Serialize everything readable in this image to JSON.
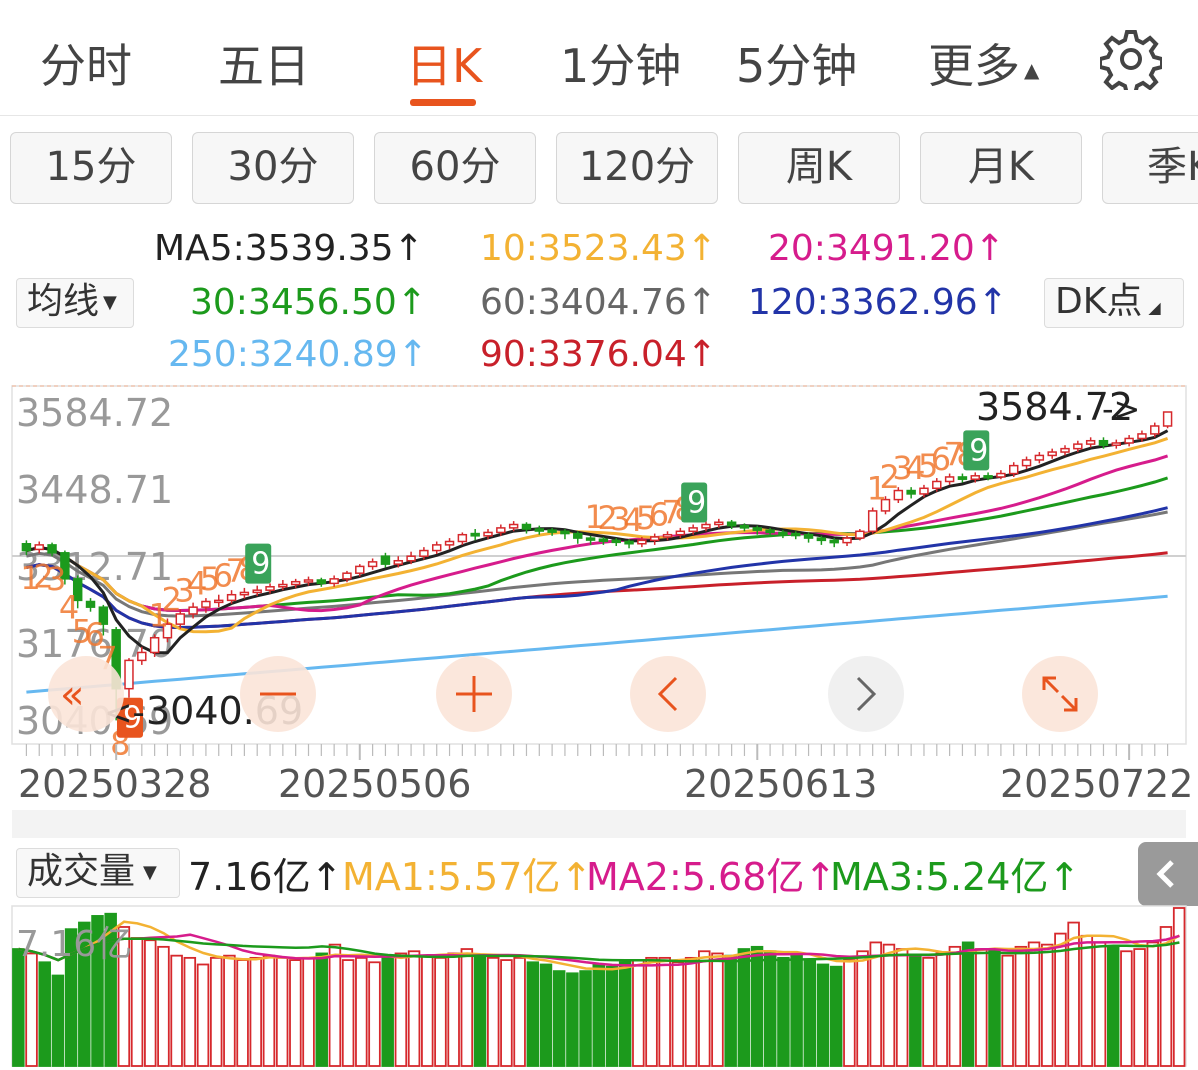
{
  "tabs": [
    {
      "label": "分时"
    },
    {
      "label": "五日"
    },
    {
      "label": "日K"
    },
    {
      "label": "1分钟"
    },
    {
      "label": "5分钟"
    },
    {
      "label": "更多"
    }
  ],
  "active_tab": "日K",
  "periods": [
    {
      "label": "15分"
    },
    {
      "label": "30分"
    },
    {
      "label": "60分"
    },
    {
      "label": "120分"
    },
    {
      "label": "周K"
    },
    {
      "label": "月K"
    },
    {
      "label": "季K"
    }
  ],
  "ma_selector": "均线",
  "dk_button": "DK点",
  "ma_legend": {
    "ma5": "MA5:3539.35↑",
    "ma10": "10:3523.43↑",
    "ma20": "20:3491.20↑",
    "ma30": "30:3456.50↑",
    "ma60": "60:3404.76↑",
    "ma120": "120:3362.96↑",
    "ma250": "250:3240.89↑",
    "ma90": "90:3376.04↑"
  },
  "colors": {
    "accent": "#e8541e",
    "up": "#d6282c",
    "down": "#1c9a1c",
    "ma5": "#222222",
    "ma10": "#f3b233",
    "ma20": "#d61c8c",
    "ma30": "#1c9a1c",
    "ma60": "#777777",
    "ma90": "#c8202a",
    "ma120": "#2234a8",
    "ma250": "#66b8f0"
  },
  "chart_data": [
    {
      "type": "candlestick",
      "y_axis_labels": [
        "3584.72",
        "3448.71",
        "3312.71",
        "3176.70",
        "3040.69"
      ],
      "ylim": [
        3040.69,
        3584.72
      ],
      "x_axis_labels": [
        "20250328",
        "20250506",
        "20250613",
        "20250722"
      ],
      "annotations": {
        "high": "3584.72",
        "low": "3040.69"
      },
      "candles": [
        {
          "o": 3352,
          "c": 3340,
          "h": 3358,
          "l": 3332
        },
        {
          "o": 3342,
          "c": 3350,
          "h": 3356,
          "l": 3335
        },
        {
          "o": 3350,
          "c": 3336,
          "h": 3354,
          "l": 3330
        },
        {
          "o": 3336,
          "c": 3290,
          "h": 3340,
          "l": 3280
        },
        {
          "o": 3290,
          "c": 3252,
          "h": 3296,
          "l": 3238
        },
        {
          "o": 3250,
          "c": 3240,
          "h": 3256,
          "l": 3232
        },
        {
          "o": 3240,
          "c": 3210,
          "h": 3244,
          "l": 3190
        },
        {
          "o": 3200,
          "c": 3096,
          "h": 3205,
          "l": 3040
        },
        {
          "o": 3096,
          "c": 3146,
          "h": 3150,
          "l": 3080
        },
        {
          "o": 3146,
          "c": 3160,
          "h": 3170,
          "l": 3138
        },
        {
          "o": 3160,
          "c": 3186,
          "h": 3192,
          "l": 3152
        },
        {
          "o": 3186,
          "c": 3210,
          "h": 3220,
          "l": 3178
        },
        {
          "o": 3210,
          "c": 3228,
          "h": 3236,
          "l": 3202
        },
        {
          "o": 3228,
          "c": 3240,
          "h": 3248,
          "l": 3220
        },
        {
          "o": 3240,
          "c": 3250,
          "h": 3256,
          "l": 3230
        },
        {
          "o": 3250,
          "c": 3252,
          "h": 3262,
          "l": 3240
        },
        {
          "o": 3252,
          "c": 3262,
          "h": 3270,
          "l": 3246
        },
        {
          "o": 3262,
          "c": 3266,
          "h": 3274,
          "l": 3255
        },
        {
          "o": 3266,
          "c": 3270,
          "h": 3278,
          "l": 3260
        },
        {
          "o": 3270,
          "c": 3276,
          "h": 3282,
          "l": 3264
        },
        {
          "o": 3276,
          "c": 3280,
          "h": 3288,
          "l": 3270
        },
        {
          "o": 3280,
          "c": 3285,
          "h": 3290,
          "l": 3274
        },
        {
          "o": 3285,
          "c": 3288,
          "h": 3294,
          "l": 3278
        },
        {
          "o": 3288,
          "c": 3282,
          "h": 3292,
          "l": 3276
        },
        {
          "o": 3282,
          "c": 3290,
          "h": 3296,
          "l": 3276
        },
        {
          "o": 3290,
          "c": 3300,
          "h": 3304,
          "l": 3284
        },
        {
          "o": 3300,
          "c": 3312,
          "h": 3316,
          "l": 3294
        },
        {
          "o": 3312,
          "c": 3320,
          "h": 3326,
          "l": 3306
        },
        {
          "o": 3330,
          "c": 3316,
          "h": 3336,
          "l": 3310
        },
        {
          "o": 3316,
          "c": 3322,
          "h": 3330,
          "l": 3310
        },
        {
          "o": 3322,
          "c": 3330,
          "h": 3338,
          "l": 3316
        },
        {
          "o": 3330,
          "c": 3340,
          "h": 3346,
          "l": 3324
        },
        {
          "o": 3340,
          "c": 3350,
          "h": 3356,
          "l": 3334
        },
        {
          "o": 3350,
          "c": 3356,
          "h": 3362,
          "l": 3342
        },
        {
          "o": 3356,
          "c": 3368,
          "h": 3372,
          "l": 3350
        },
        {
          "o": 3370,
          "c": 3366,
          "h": 3378,
          "l": 3358
        },
        {
          "o": 3366,
          "c": 3372,
          "h": 3378,
          "l": 3360
        },
        {
          "o": 3372,
          "c": 3380,
          "h": 3386,
          "l": 3366
        },
        {
          "o": 3380,
          "c": 3386,
          "h": 3392,
          "l": 3374
        },
        {
          "o": 3386,
          "c": 3378,
          "h": 3390,
          "l": 3370
        },
        {
          "o": 3378,
          "c": 3376,
          "h": 3384,
          "l": 3368
        },
        {
          "o": 3376,
          "c": 3374,
          "h": 3380,
          "l": 3366
        },
        {
          "o": 3374,
          "c": 3370,
          "h": 3378,
          "l": 3360
        },
        {
          "o": 3370,
          "c": 3362,
          "h": 3374,
          "l": 3352
        },
        {
          "o": 3362,
          "c": 3360,
          "h": 3366,
          "l": 3350
        },
        {
          "o": 3360,
          "c": 3358,
          "h": 3364,
          "l": 3350
        },
        {
          "o": 3358,
          "c": 3356,
          "h": 3362,
          "l": 3348
        },
        {
          "o": 3356,
          "c": 3352,
          "h": 3360,
          "l": 3344
        },
        {
          "o": 3352,
          "c": 3358,
          "h": 3364,
          "l": 3346
        },
        {
          "o": 3358,
          "c": 3364,
          "h": 3370,
          "l": 3350
        },
        {
          "o": 3364,
          "c": 3368,
          "h": 3374,
          "l": 3358
        },
        {
          "o": 3368,
          "c": 3374,
          "h": 3380,
          "l": 3362
        },
        {
          "o": 3374,
          "c": 3380,
          "h": 3386,
          "l": 3368
        },
        {
          "o": 3380,
          "c": 3386,
          "h": 3392,
          "l": 3374
        },
        {
          "o": 3386,
          "c": 3390,
          "h": 3396,
          "l": 3380
        },
        {
          "o": 3390,
          "c": 3384,
          "h": 3394,
          "l": 3378
        },
        {
          "o": 3384,
          "c": 3380,
          "h": 3388,
          "l": 3374
        },
        {
          "o": 3380,
          "c": 3376,
          "h": 3384,
          "l": 3368
        },
        {
          "o": 3376,
          "c": 3372,
          "h": 3380,
          "l": 3364
        },
        {
          "o": 3372,
          "c": 3370,
          "h": 3376,
          "l": 3362
        },
        {
          "o": 3370,
          "c": 3368,
          "h": 3374,
          "l": 3360
        },
        {
          "o": 3368,
          "c": 3362,
          "h": 3372,
          "l": 3354
        },
        {
          "o": 3362,
          "c": 3358,
          "h": 3366,
          "l": 3350
        },
        {
          "o": 3358,
          "c": 3354,
          "h": 3362,
          "l": 3346
        },
        {
          "o": 3354,
          "c": 3362,
          "h": 3366,
          "l": 3348
        },
        {
          "o": 3362,
          "c": 3374,
          "h": 3378,
          "l": 3358
        },
        {
          "o": 3374,
          "c": 3410,
          "h": 3416,
          "l": 3370
        },
        {
          "o": 3410,
          "c": 3430,
          "h": 3436,
          "l": 3404
        },
        {
          "o": 3430,
          "c": 3446,
          "h": 3452,
          "l": 3424
        },
        {
          "o": 3446,
          "c": 3440,
          "h": 3452,
          "l": 3432
        },
        {
          "o": 3440,
          "c": 3450,
          "h": 3456,
          "l": 3434
        },
        {
          "o": 3450,
          "c": 3462,
          "h": 3468,
          "l": 3444
        },
        {
          "o": 3462,
          "c": 3470,
          "h": 3476,
          "l": 3456
        },
        {
          "o": 3470,
          "c": 3466,
          "h": 3476,
          "l": 3460
        },
        {
          "o": 3466,
          "c": 3472,
          "h": 3478,
          "l": 3460
        },
        {
          "o": 3472,
          "c": 3470,
          "h": 3478,
          "l": 3464
        },
        {
          "o": 3470,
          "c": 3476,
          "h": 3482,
          "l": 3466
        },
        {
          "o": 3476,
          "c": 3490,
          "h": 3496,
          "l": 3470
        },
        {
          "o": 3490,
          "c": 3500,
          "h": 3506,
          "l": 3484
        },
        {
          "o": 3500,
          "c": 3508,
          "h": 3514,
          "l": 3494
        },
        {
          "o": 3508,
          "c": 3514,
          "h": 3520,
          "l": 3502
        },
        {
          "o": 3514,
          "c": 3520,
          "h": 3526,
          "l": 3508
        },
        {
          "o": 3520,
          "c": 3528,
          "h": 3534,
          "l": 3514
        },
        {
          "o": 3528,
          "c": 3534,
          "h": 3540,
          "l": 3522
        },
        {
          "o": 3534,
          "c": 3526,
          "h": 3540,
          "l": 3520
        },
        {
          "o": 3526,
          "c": 3530,
          "h": 3536,
          "l": 3520
        },
        {
          "o": 3530,
          "c": 3538,
          "h": 3544,
          "l": 3524
        },
        {
          "o": 3538,
          "c": 3546,
          "h": 3552,
          "l": 3532
        },
        {
          "o": 3546,
          "c": 3560,
          "h": 3566,
          "l": 3540
        },
        {
          "o": 3560,
          "c": 3584.72,
          "h": 3584.72,
          "l": 3556
        }
      ]
    },
    {
      "type": "bar",
      "title": "成交量",
      "legend": {
        "selector": "成交量",
        "value": "7.16亿↑",
        "ma1": "MA1:5.57亿↑",
        "ma2": "MA2:5.68亿↑",
        "ma3": "MA3:5.24亿↑"
      },
      "y_axis_label": "7.16亿",
      "unit": "亿",
      "values": [
        5.3,
        5.1,
        4.7,
        4.1,
        6.2,
        6.5,
        6.8,
        6.9,
        6.3,
        5.8,
        5.7,
        5.4,
        5.0,
        4.9,
        4.6,
        4.9,
        5.0,
        4.8,
        4.9,
        5.0,
        4.9,
        4.8,
        4.9,
        5.1,
        5.5,
        4.8,
        4.9,
        4.7,
        5.0,
        5.1,
        5.2,
        5.0,
        4.9,
        5.1,
        5.3,
        5.0,
        4.9,
        4.8,
        4.9,
        4.7,
        4.6,
        4.3,
        4.2,
        4.3,
        4.6,
        4.5,
        4.7,
        4.8,
        4.9,
        4.9,
        4.7,
        4.9,
        5.2,
        5.1,
        5.0,
        5.3,
        5.4,
        5.2,
        4.9,
        5.0,
        4.8,
        4.6,
        4.5,
        4.8,
        5.2,
        5.6,
        5.5,
        5.3,
        5.0,
        4.9,
        5.1,
        5.4,
        5.6,
        5.3,
        5.2,
        5.0,
        5.4,
        5.6,
        5.5,
        6.0,
        6.5,
        5.9,
        5.6,
        5.4,
        5.2,
        5.3,
        5.6,
        6.3,
        7.16
      ],
      "ylim": [
        0,
        7.16
      ]
    }
  ]
}
